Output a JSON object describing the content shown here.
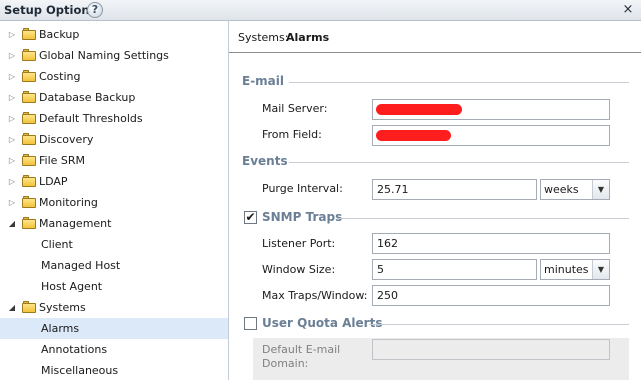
{
  "window": {
    "title": "Setup Options",
    "help_symbol": "?",
    "close_symbol": "×"
  },
  "sidebar": {
    "items": [
      {
        "label": "Backup",
        "type": "folder",
        "expanded": false
      },
      {
        "label": "Global Naming Settings",
        "type": "folder",
        "expanded": false
      },
      {
        "label": "Costing",
        "type": "folder",
        "expanded": false
      },
      {
        "label": "Database Backup",
        "type": "folder",
        "expanded": false
      },
      {
        "label": "Default Thresholds",
        "type": "folder",
        "expanded": false
      },
      {
        "label": "Discovery",
        "type": "folder",
        "expanded": false
      },
      {
        "label": "File SRM",
        "type": "folder",
        "expanded": false
      },
      {
        "label": "LDAP",
        "type": "folder",
        "expanded": false
      },
      {
        "label": "Monitoring",
        "type": "folder",
        "expanded": false
      },
      {
        "label": "Management",
        "type": "folder",
        "expanded": true
      },
      {
        "label": "Client",
        "type": "leaf"
      },
      {
        "label": "Managed Host",
        "type": "leaf"
      },
      {
        "label": "Host Agent",
        "type": "leaf"
      },
      {
        "label": "Systems",
        "type": "folder",
        "expanded": true
      },
      {
        "label": "Alarms",
        "type": "leaf",
        "selected": true
      },
      {
        "label": "Annotations",
        "type": "leaf"
      },
      {
        "label": "Miscellaneous",
        "type": "leaf"
      }
    ]
  },
  "main": {
    "header_prefix": "Systems:",
    "header_page": "Alarms",
    "email": {
      "title": "E-mail",
      "mail_server_label": "Mail Server:",
      "from_field_label": "From Field:"
    },
    "events": {
      "title": "Events",
      "purge_interval_label": "Purge Interval:",
      "purge_interval_value": "25.71",
      "purge_interval_unit": "weeks"
    },
    "snmp": {
      "title": "SNMP Traps",
      "checked": true,
      "check_symbol": "✔",
      "listener_port_label": "Listener Port:",
      "listener_port_value": "162",
      "window_size_label": "Window Size:",
      "window_size_value": "5",
      "window_size_unit": "minutes",
      "max_traps_label": "Max Traps/Window:",
      "max_traps_value": "250"
    },
    "quota": {
      "title": "User Quota Alerts",
      "checked": false,
      "default_email_label_line1": "Default E-mail",
      "default_email_label_line2": "Domain:"
    },
    "dropdown_arrow": "▼"
  },
  "colors": {
    "section_title": "#6a7f96",
    "selected_row": "#dbe9f8",
    "redaction": "#ff1e1e"
  }
}
